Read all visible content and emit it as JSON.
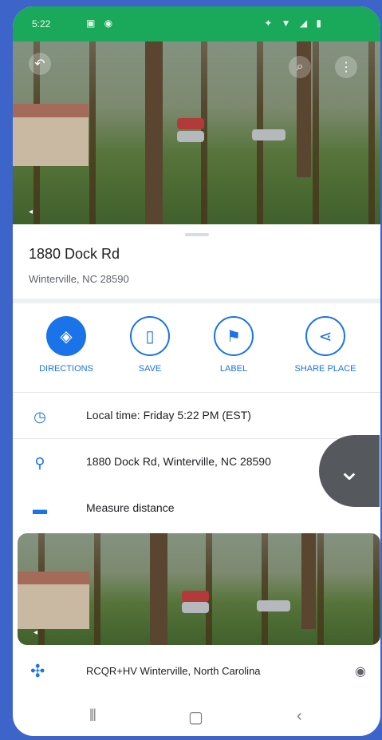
{
  "status_bar": {
    "time": "5:22",
    "left_icons": "▣ ◉",
    "right_icons": "✦ ▼ ◢ ▮"
  },
  "top_photo": {
    "tag": "◂"
  },
  "place": {
    "title": "1880 Dock Rd",
    "subtitle": "Winterville, NC 28590"
  },
  "actions": [
    {
      "label": "DIRECTIONS",
      "icon": "directions-icon"
    },
    {
      "label": "SAVE",
      "icon": "bookmark-icon"
    },
    {
      "label": "LABEL",
      "icon": "flag-icon"
    },
    {
      "label": "SHARE PLACE",
      "icon": "share-icon"
    }
  ],
  "info_rows": {
    "local_time": "Local time: Friday 5:22 PM (EST)",
    "address": "1880 Dock Rd, Winterville, NC 28590",
    "measure": "Measure distance"
  },
  "bottom_photo": {
    "tag": "◂"
  },
  "location_row": {
    "text": "RCQR+HV Winterville, North Carolina"
  },
  "colors": {
    "accent": "#1a73e8",
    "status_bar": "#1aa85b",
    "frame": "#3d64c8",
    "fab": "#55585c"
  }
}
